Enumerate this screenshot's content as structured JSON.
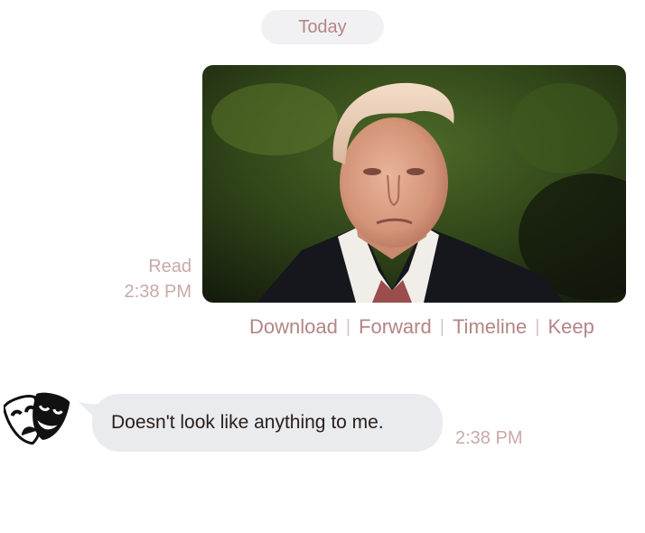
{
  "date_separator": {
    "label": "Today"
  },
  "outgoing_message": {
    "image": "photo-portrait",
    "status": "Read",
    "time": "2:38 PM",
    "actions": [
      {
        "label": "Download"
      },
      {
        "label": "Forward"
      },
      {
        "label": "Timeline"
      },
      {
        "label": "Keep"
      }
    ],
    "action_separator": "|"
  },
  "incoming_message": {
    "avatar_icon": "theater-masks-icon",
    "text": "Doesn't look like anything to me.",
    "time": "2:38 PM"
  },
  "colors": {
    "accent_text": "#b48585",
    "meta_text": "#c9a9a9",
    "bubble_bg": "#e9ebee",
    "pill_bg": "#f1f1f3"
  }
}
